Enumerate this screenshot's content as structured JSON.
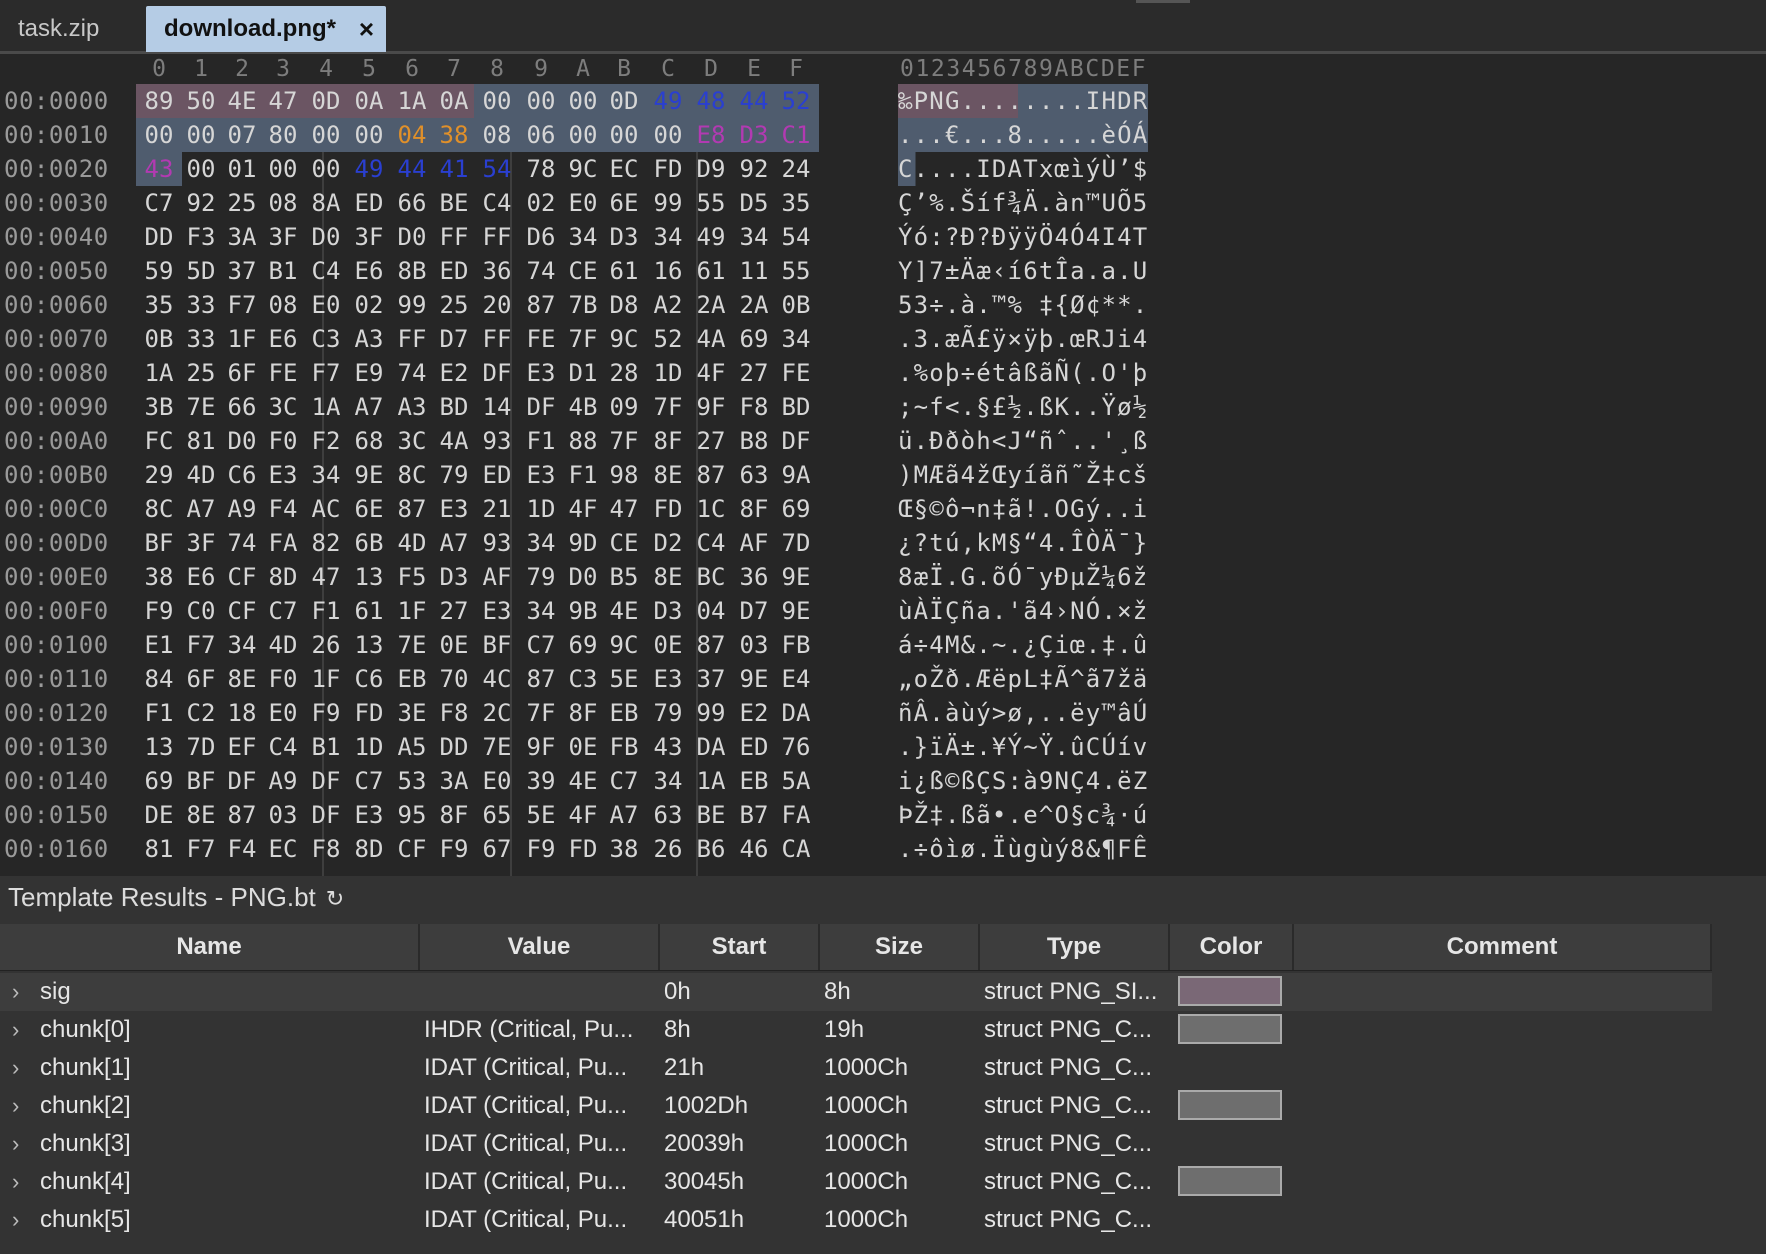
{
  "tabs": [
    {
      "label": "task.zip"
    },
    {
      "label": "download.png*",
      "close": "×"
    }
  ],
  "hex": {
    "col_headers": [
      "0",
      "1",
      "2",
      "3",
      "4",
      "5",
      "6",
      "7",
      "8",
      "9",
      "A",
      "B",
      "C",
      "D",
      "E",
      "F"
    ],
    "ascii_header": "0123456789ABCDEF",
    "rows": [
      {
        "addr": "00:0000",
        "bytes": [
          "89",
          "50",
          "4E",
          "47",
          "0D",
          "0A",
          "1A",
          "0A",
          "00",
          "00",
          "00",
          "0D",
          "49",
          "48",
          "44",
          "52"
        ],
        "ascii": "‰PNG........IHDR"
      },
      {
        "addr": "00:0010",
        "bytes": [
          "00",
          "00",
          "07",
          "80",
          "00",
          "00",
          "04",
          "38",
          "08",
          "06",
          "00",
          "00",
          "00",
          "E8",
          "D3",
          "C1"
        ],
        "ascii": "...€...8.....èÓÁ"
      },
      {
        "addr": "00:0020",
        "bytes": [
          "43",
          "00",
          "01",
          "00",
          "00",
          "49",
          "44",
          "41",
          "54",
          "78",
          "9C",
          "EC",
          "FD",
          "D9",
          "92",
          "24"
        ],
        "ascii": "C....IDATxœìýÙ’$"
      },
      {
        "addr": "00:0030",
        "bytes": [
          "C7",
          "92",
          "25",
          "08",
          "8A",
          "ED",
          "66",
          "BE",
          "C4",
          "02",
          "E0",
          "6E",
          "99",
          "55",
          "D5",
          "35"
        ],
        "ascii": "Ç’%.Šíf¾Ä.àn™UÕ5"
      },
      {
        "addr": "00:0040",
        "bytes": [
          "DD",
          "F3",
          "3A",
          "3F",
          "D0",
          "3F",
          "D0",
          "FF",
          "FF",
          "D6",
          "34",
          "D3",
          "34",
          "49",
          "34",
          "54"
        ],
        "ascii": "Ýó:?Ð?ÐÿÿÖ4Ó4I4T"
      },
      {
        "addr": "00:0050",
        "bytes": [
          "59",
          "5D",
          "37",
          "B1",
          "C4",
          "E6",
          "8B",
          "ED",
          "36",
          "74",
          "CE",
          "61",
          "16",
          "61",
          "11",
          "55"
        ],
        "ascii": "Y]7±Äæ‹í6tÎa.a.U"
      },
      {
        "addr": "00:0060",
        "bytes": [
          "35",
          "33",
          "F7",
          "08",
          "E0",
          "02",
          "99",
          "25",
          "20",
          "87",
          "7B",
          "D8",
          "A2",
          "2A",
          "2A",
          "0B"
        ],
        "ascii": "53÷.à.™% ‡{Ø¢**."
      },
      {
        "addr": "00:0070",
        "bytes": [
          "0B",
          "33",
          "1F",
          "E6",
          "C3",
          "A3",
          "FF",
          "D7",
          "FF",
          "FE",
          "7F",
          "9C",
          "52",
          "4A",
          "69",
          "34"
        ],
        "ascii": ".3.æÃ£ÿ×ÿþ.œRJi4"
      },
      {
        "addr": "00:0080",
        "bytes": [
          "1A",
          "25",
          "6F",
          "FE",
          "F7",
          "E9",
          "74",
          "E2",
          "DF",
          "E3",
          "D1",
          "28",
          "1D",
          "4F",
          "27",
          "FE"
        ],
        "ascii": ".%oþ÷étâßãÑ(.O'þ"
      },
      {
        "addr": "00:0090",
        "bytes": [
          "3B",
          "7E",
          "66",
          "3C",
          "1A",
          "A7",
          "A3",
          "BD",
          "14",
          "DF",
          "4B",
          "09",
          "7F",
          "9F",
          "F8",
          "BD"
        ],
        "ascii": ";~f<.§£½.ßK..Ÿø½"
      },
      {
        "addr": "00:00A0",
        "bytes": [
          "FC",
          "81",
          "D0",
          "F0",
          "F2",
          "68",
          "3C",
          "4A",
          "93",
          "F1",
          "88",
          "7F",
          "8F",
          "27",
          "B8",
          "DF"
        ],
        "ascii": "ü.Ððòh<J“ñˆ..'¸ß"
      },
      {
        "addr": "00:00B0",
        "bytes": [
          "29",
          "4D",
          "C6",
          "E3",
          "34",
          "9E",
          "8C",
          "79",
          "ED",
          "E3",
          "F1",
          "98",
          "8E",
          "87",
          "63",
          "9A"
        ],
        "ascii": ")MÆã4žŒyíãñ˜Ž‡cš"
      },
      {
        "addr": "00:00C0",
        "bytes": [
          "8C",
          "A7",
          "A9",
          "F4",
          "AC",
          "6E",
          "87",
          "E3",
          "21",
          "1D",
          "4F",
          "47",
          "FD",
          "1C",
          "8F",
          "69"
        ],
        "ascii": "Œ§©ô¬n‡ã!.OGý..i"
      },
      {
        "addr": "00:00D0",
        "bytes": [
          "BF",
          "3F",
          "74",
          "FA",
          "82",
          "6B",
          "4D",
          "A7",
          "93",
          "34",
          "9D",
          "CE",
          "D2",
          "C4",
          "AF",
          "7D"
        ],
        "ascii": "¿?tú‚kM§“4.ÎÒÄ¯}"
      },
      {
        "addr": "00:00E0",
        "bytes": [
          "38",
          "E6",
          "CF",
          "8D",
          "47",
          "13",
          "F5",
          "D3",
          "AF",
          "79",
          "D0",
          "B5",
          "8E",
          "BC",
          "36",
          "9E"
        ],
        "ascii": "8æÏ.G.õÓ¯yÐµŽ¼6ž"
      },
      {
        "addr": "00:00F0",
        "bytes": [
          "F9",
          "C0",
          "CF",
          "C7",
          "F1",
          "61",
          "1F",
          "27",
          "E3",
          "34",
          "9B",
          "4E",
          "D3",
          "04",
          "D7",
          "9E"
        ],
        "ascii": "ùÀÏÇña.'ã4›NÓ.×ž"
      },
      {
        "addr": "00:0100",
        "bytes": [
          "E1",
          "F7",
          "34",
          "4D",
          "26",
          "13",
          "7E",
          "0E",
          "BF",
          "C7",
          "69",
          "9C",
          "0E",
          "87",
          "03",
          "FB"
        ],
        "ascii": "á÷4M&.~.¿Çiœ.‡.û"
      },
      {
        "addr": "00:0110",
        "bytes": [
          "84",
          "6F",
          "8E",
          "F0",
          "1F",
          "C6",
          "EB",
          "70",
          "4C",
          "87",
          "C3",
          "5E",
          "E3",
          "37",
          "9E",
          "E4"
        ],
        "ascii": "„oŽð.ÆëpL‡Ã^ã7žä"
      },
      {
        "addr": "00:0120",
        "bytes": [
          "F1",
          "C2",
          "18",
          "E0",
          "F9",
          "FD",
          "3E",
          "F8",
          "2C",
          "7F",
          "8F",
          "EB",
          "79",
          "99",
          "E2",
          "DA"
        ],
        "ascii": "ñÂ.àùý>ø,..ëy™âÚ"
      },
      {
        "addr": "00:0130",
        "bytes": [
          "13",
          "7D",
          "EF",
          "C4",
          "B1",
          "1D",
          "A5",
          "DD",
          "7E",
          "9F",
          "0E",
          "FB",
          "43",
          "DA",
          "ED",
          "76"
        ],
        "ascii": ".}ïÄ±.¥Ý~Ÿ.ûCÚív"
      },
      {
        "addr": "00:0140",
        "bytes": [
          "69",
          "BF",
          "DF",
          "A9",
          "DF",
          "C7",
          "53",
          "3A",
          "E0",
          "39",
          "4E",
          "C7",
          "34",
          "1A",
          "EB",
          "5A"
        ],
        "ascii": "i¿ß©ßÇS:à9NÇ4.ëZ"
      },
      {
        "addr": "00:0150",
        "bytes": [
          "DE",
          "8E",
          "87",
          "03",
          "DF",
          "E3",
          "95",
          "8F",
          "65",
          "5E",
          "4F",
          "A7",
          "63",
          "BE",
          "B7",
          "FA"
        ],
        "ascii": "ÞŽ‡.ßã•.e^O§c¾·ú"
      },
      {
        "addr": "00:0160",
        "bytes": [
          "81",
          "F7",
          "F4",
          "EC",
          "F8",
          "8D",
          "CF",
          "F9",
          "67",
          "F9",
          "FD",
          "38",
          "26",
          "B6",
          "46",
          "CA"
        ],
        "ascii": ".÷ôìø.Ïùgùý8&¶FÊ"
      }
    ]
  },
  "template": {
    "title": "Template Results - PNG.bt",
    "refresh_icon": "↻",
    "columns": [
      "Name",
      "Value",
      "Start",
      "Size",
      "Type",
      "Color",
      "Comment"
    ],
    "rows": [
      {
        "name": "sig",
        "value": "",
        "start": "0h",
        "size": "8h",
        "type": "struct PNG_SI...",
        "swatch": "#7a6876"
      },
      {
        "name": "chunk[0]",
        "value": "IHDR  (Critical, Pu...",
        "start": "8h",
        "size": "19h",
        "type": "struct PNG_C...",
        "swatch": "#6e6e6e"
      },
      {
        "name": "chunk[1]",
        "value": "IDAT  (Critical, Pu...",
        "start": "21h",
        "size": "1000Ch",
        "type": "struct PNG_C...",
        "swatch": ""
      },
      {
        "name": "chunk[2]",
        "value": "IDAT  (Critical, Pu...",
        "start": "1002Dh",
        "size": "1000Ch",
        "type": "struct PNG_C...",
        "swatch": "#6e6e6e"
      },
      {
        "name": "chunk[3]",
        "value": "IDAT  (Critical, Pu...",
        "start": "20039h",
        "size": "1000Ch",
        "type": "struct PNG_C...",
        "swatch": ""
      },
      {
        "name": "chunk[4]",
        "value": "IDAT  (Critical, Pu...",
        "start": "30045h",
        "size": "1000Ch",
        "type": "struct PNG_C...",
        "swatch": "#6e6e6e"
      },
      {
        "name": "chunk[5]",
        "value": "IDAT  (Critical, Pu...",
        "start": "40051h",
        "size": "1000Ch",
        "type": "struct PNG_C...",
        "swatch": ""
      }
    ]
  },
  "colors": {
    "sig_highlight": "#6b5563",
    "chunk_highlight": "#4f5c6e",
    "type_blue": "#2a3fd0",
    "crc_magenta": "#b23ab2",
    "ihdr_value_orange": "#e0902a",
    "tab_active": "#b5cce5"
  }
}
